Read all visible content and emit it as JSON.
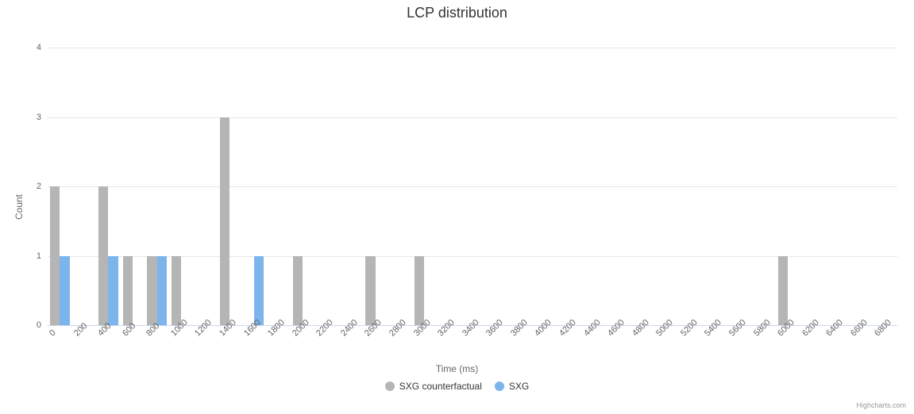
{
  "chart_data": {
    "type": "bar",
    "title": "LCP distribution",
    "xlabel": "Time (ms)",
    "ylabel": "Count",
    "ylim": [
      0,
      4
    ],
    "y_ticks": [
      0,
      1,
      2,
      3,
      4
    ],
    "categories": [
      0,
      200,
      400,
      600,
      800,
      1000,
      1200,
      1400,
      1600,
      1800,
      2000,
      2200,
      2400,
      2600,
      2800,
      3000,
      3200,
      3400,
      3600,
      3800,
      4000,
      4200,
      4400,
      4600,
      4800,
      5000,
      5200,
      5400,
      5600,
      5800,
      6000,
      6200,
      6400,
      6600,
      6800
    ],
    "series": [
      {
        "name": "SXG counterfactual",
        "color": "#b5b5b5",
        "values": [
          2,
          0,
          2,
          1,
          1,
          1,
          0,
          3,
          0,
          0,
          1,
          0,
          0,
          1,
          0,
          1,
          0,
          0,
          0,
          0,
          0,
          0,
          0,
          0,
          0,
          0,
          0,
          0,
          0,
          0,
          1,
          0,
          0,
          0,
          0
        ]
      },
      {
        "name": "SXG",
        "color": "#7cb5ec",
        "values": [
          1,
          0,
          1,
          0,
          1,
          0,
          0,
          0,
          1,
          0,
          0,
          0,
          0,
          0,
          0,
          0,
          0,
          0,
          0,
          0,
          0,
          0,
          0,
          0,
          0,
          0,
          0,
          0,
          0,
          0,
          0,
          0,
          0,
          0,
          0
        ]
      }
    ]
  },
  "credits": "Highcharts.com"
}
